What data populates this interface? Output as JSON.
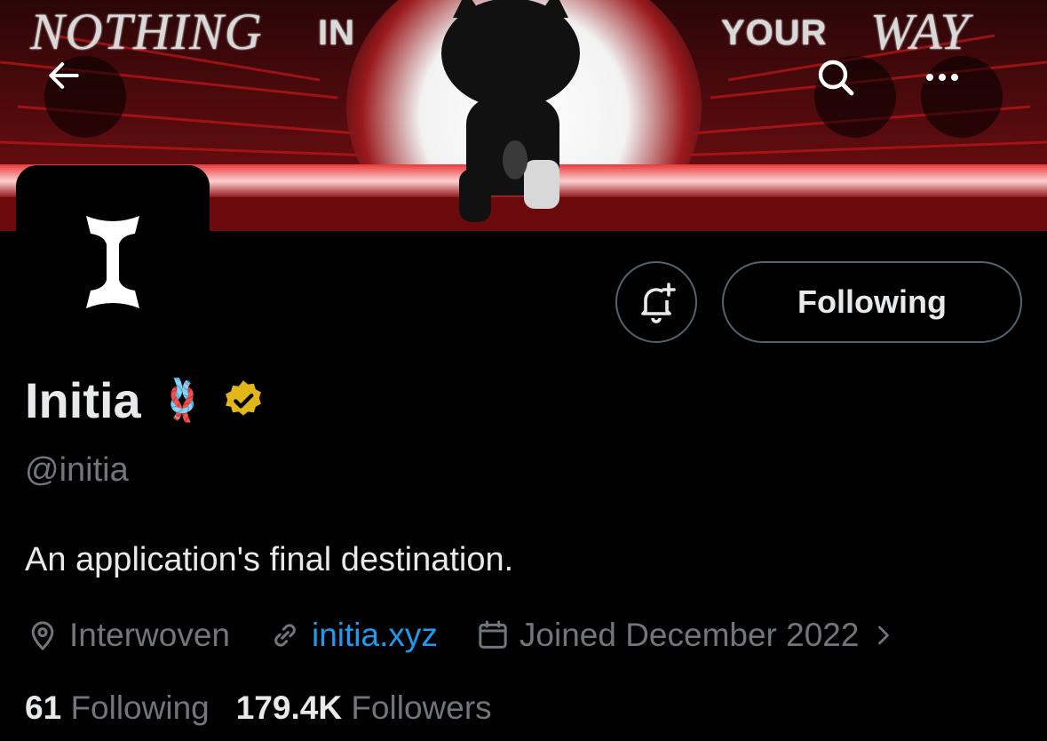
{
  "banner": {
    "word_left_italic": "NOTHING",
    "word_left_plain": "IN",
    "word_right_plain": "YOUR",
    "word_right_italic": "WAY"
  },
  "nav": {
    "back_icon": "arrow-left-icon",
    "search_icon": "search-icon",
    "more_icon": "more-horizontal-icon"
  },
  "profile": {
    "avatar_glyph": "I",
    "display_name": "Initia",
    "name_emoji": "🪢",
    "verified_badge_color": "#e2b719",
    "handle": "@initia",
    "bio": "An application's final destination."
  },
  "actions": {
    "notify_icon": "bell-plus-icon",
    "following_label": "Following"
  },
  "meta": {
    "location": "Interwoven",
    "website": "initia.xyz",
    "joined": "Joined December 2022"
  },
  "stats": {
    "following_count": "61",
    "following_label": "Following",
    "followers_count": "179.4K",
    "followers_label": "Followers"
  },
  "colors": {
    "background": "#000000",
    "text_primary": "#e7e9ea",
    "text_secondary": "#71767b",
    "link": "#1d9bf0",
    "border": "#536471"
  }
}
